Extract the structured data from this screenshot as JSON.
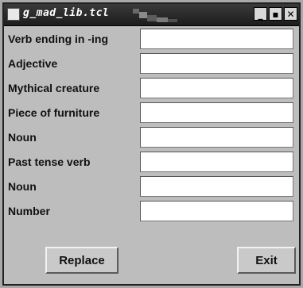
{
  "window": {
    "title": "g_mad_lib.tcl",
    "minimize_glyph": "_",
    "maximize_glyph": "▪",
    "close_glyph": "✕"
  },
  "form": {
    "fields": [
      {
        "label": "Verb ending in -ing",
        "value": ""
      },
      {
        "label": "Adjective",
        "value": ""
      },
      {
        "label": "Mythical creature",
        "value": ""
      },
      {
        "label": "Piece of furniture",
        "value": ""
      },
      {
        "label": "Noun",
        "value": ""
      },
      {
        "label": "Past tense verb",
        "value": ""
      },
      {
        "label": "Noun",
        "value": ""
      },
      {
        "label": "Number",
        "value": ""
      }
    ]
  },
  "buttons": {
    "replace_label": "Replace",
    "exit_label": "Exit"
  }
}
